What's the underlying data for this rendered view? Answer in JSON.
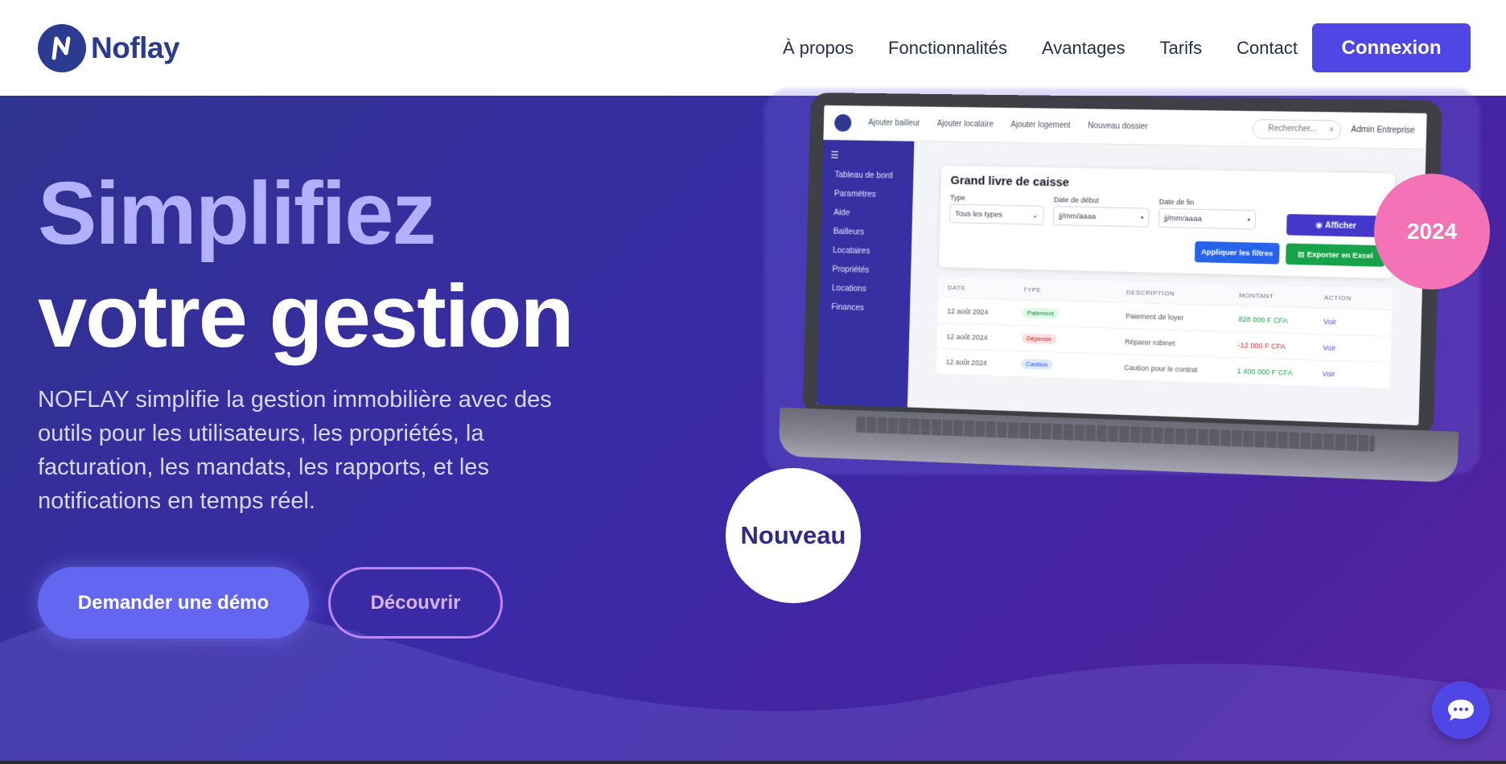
{
  "nav": {
    "brand": "Noflay",
    "links": [
      "À propos",
      "Fonctionnalités",
      "Avantages",
      "Tarifs",
      "Contact"
    ],
    "login": "Connexion"
  },
  "hero": {
    "title_line1": "Simplifiez",
    "title_line2": "votre gestion",
    "description": "NOFLAY simplifie la gestion immobilière avec des outils pour les utilisateurs, les propriétés, la facturation, les mandats, les rapports, et les notifications en temps réel.",
    "cta_primary": "Demander une démo",
    "cta_secondary": "Découvrir",
    "badge_year": "2024",
    "badge_new": "Nouveau"
  },
  "mockup": {
    "top_links": [
      "Ajouter bailleur",
      "Ajouter locataire",
      "Ajouter logement",
      "Nouveau dossier"
    ],
    "search_placeholder": "Rechercher...",
    "admin": "Admin Entreprise",
    "sidebar": [
      "Tableau de bord",
      "Paramètres",
      "Aide",
      "Bailleurs",
      "Locataires",
      "Propriétés",
      "Locations",
      "Finances"
    ],
    "card_title": "Grand livre de caisse",
    "filters": {
      "type_label": "Type",
      "type_value": "Tous les types",
      "start_label": "Date de début",
      "start_value": "jj/mm/aaaa",
      "end_label": "Date de fin",
      "end_value": "jj/mm/aaaa"
    },
    "btn_show": "Afficher",
    "btn_filters": "Appliquer les filtres",
    "btn_excel": "Exporter en Excel",
    "table_headers": [
      "DATE",
      "TYPE",
      "DESCRIPTION",
      "MONTANT",
      "ACTION"
    ],
    "rows": [
      {
        "date": "12 août 2024",
        "type": "Paiement",
        "desc": "Paiement de loyer",
        "amount": "828 000 F CFA",
        "action": "Voir"
      },
      {
        "date": "12 août 2024",
        "type": "Dépense",
        "desc": "Réparer robinet",
        "amount": "-12 000 F CFA",
        "action": "Voir"
      },
      {
        "date": "12 août 2024",
        "type": "Caution",
        "desc": "Caution pour le contrat",
        "amount": "1 400 000 F CFA",
        "action": "Voir"
      }
    ]
  },
  "colors": {
    "primary": "#4f46e5",
    "brand_navy": "#2c3a8f",
    "hero_title_accent": "#b3b0ff",
    "badge_pink": "#f472b6"
  }
}
